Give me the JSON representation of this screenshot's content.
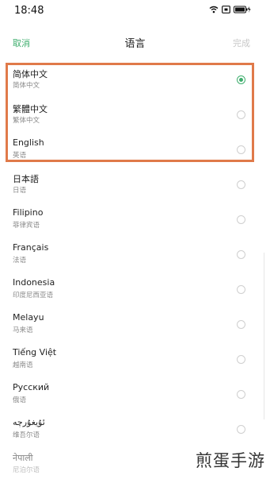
{
  "status_bar": {
    "time": "18:48",
    "icons": [
      "wifi-icon",
      "screenshot-icon",
      "battery-icon"
    ]
  },
  "nav": {
    "cancel": "取消",
    "title": "语言",
    "done": "完成"
  },
  "languages": [
    {
      "name": "简体中文",
      "sub": "简体中文",
      "selected": true
    },
    {
      "name": "繁體中文",
      "sub": "繁体中文",
      "selected": false
    },
    {
      "name": "English",
      "sub": "英语",
      "selected": false
    },
    {
      "name": "日本語",
      "sub": "日语",
      "selected": false
    },
    {
      "name": "Filipino",
      "sub": "菲律宾语",
      "selected": false
    },
    {
      "name": "Français",
      "sub": "法语",
      "selected": false
    },
    {
      "name": "Indonesia",
      "sub": "印度尼西亚语",
      "selected": false
    },
    {
      "name": "Melayu",
      "sub": "马来语",
      "selected": false
    },
    {
      "name": "Tiếng Việt",
      "sub": "越南语",
      "selected": false
    },
    {
      "name": "Русский",
      "sub": "俄语",
      "selected": false
    },
    {
      "name": "ئۇيغۇرچە",
      "sub": "维吾尔语",
      "selected": false
    },
    {
      "name": "नेपाली",
      "sub": "尼泊尔语",
      "selected": false
    }
  ],
  "watermark": "煎蛋手游",
  "colors": {
    "accent": "#3fae6e",
    "highlight": "#e07a4a"
  }
}
